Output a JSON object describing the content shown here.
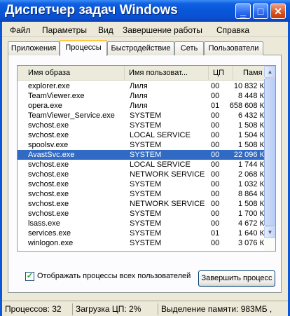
{
  "window": {
    "title": "Диспетчер задач Windows"
  },
  "menu": [
    "Файл",
    "Параметры",
    "Вид",
    "Завершение работы",
    "Справка"
  ],
  "tabs": [
    "Приложения",
    "Процессы",
    "Быстродействие",
    "Сеть",
    "Пользователи"
  ],
  "active_tab": "Процессы",
  "columns": [
    "Имя образа",
    "Имя пользоват...",
    "ЦП",
    "Памя"
  ],
  "rows": [
    {
      "name": "explorer.exe",
      "user": "Лиля",
      "cpu": "00",
      "mem": "10 832 К"
    },
    {
      "name": "TeamViewer.exe",
      "user": "Лиля",
      "cpu": "00",
      "mem": "8 448 К"
    },
    {
      "name": "opera.exe",
      "user": "Лиля",
      "cpu": "01",
      "mem": "658 608 К"
    },
    {
      "name": "TeamViewer_Service.exe",
      "user": "SYSTEM",
      "cpu": "00",
      "mem": "6 432 К"
    },
    {
      "name": "svchost.exe",
      "user": "SYSTEM",
      "cpu": "00",
      "mem": "1 508 К"
    },
    {
      "name": "svchost.exe",
      "user": "LOCAL SERVICE",
      "cpu": "00",
      "mem": "1 504 К"
    },
    {
      "name": "spoolsv.exe",
      "user": "SYSTEM",
      "cpu": "00",
      "mem": "1 508 К"
    },
    {
      "name": "AvastSvc.exe",
      "user": "SYSTEM",
      "cpu": "00",
      "mem": "22 096 К"
    },
    {
      "name": "svchost.exe",
      "user": "LOCAL SERVICE",
      "cpu": "00",
      "mem": "1 744 К"
    },
    {
      "name": "svchost.exe",
      "user": "NETWORK SERVICE",
      "cpu": "00",
      "mem": "2 068 К"
    },
    {
      "name": "svchost.exe",
      "user": "SYSTEM",
      "cpu": "00",
      "mem": "1 032 К"
    },
    {
      "name": "svchost.exe",
      "user": "SYSTEM",
      "cpu": "00",
      "mem": "8 864 К"
    },
    {
      "name": "svchost.exe",
      "user": "NETWORK SERVICE",
      "cpu": "00",
      "mem": "1 508 К"
    },
    {
      "name": "svchost.exe",
      "user": "SYSTEM",
      "cpu": "00",
      "mem": "1 700 К"
    },
    {
      "name": "lsass.exe",
      "user": "SYSTEM",
      "cpu": "00",
      "mem": "4 672 К"
    },
    {
      "name": "services.exe",
      "user": "SYSTEM",
      "cpu": "01",
      "mem": "1 640 К"
    },
    {
      "name": "winlogon.exe",
      "user": "SYSTEM",
      "cpu": "00",
      "mem": "3 076 К"
    }
  ],
  "selected_process": "AvastSvc.exe",
  "checkbox": {
    "label": "Отображать процессы всех пользователей",
    "checked": true
  },
  "end_process_button": "Завершить процесс",
  "status": {
    "processes": "Процессов: 32",
    "cpu": "Загрузка ЦП: 2%",
    "memory": "Выделение памяти: 983МБ ,"
  },
  "colors": {
    "titlebar": "#0857d9",
    "selection": "#316ac5",
    "window_bg": "#ece9d8",
    "active_tab_accent": "#ffc83c"
  },
  "icons": [
    "minimize-icon",
    "maximize-icon",
    "close-icon",
    "scroll-up-icon",
    "scroll-down-icon",
    "checkmark-icon"
  ]
}
